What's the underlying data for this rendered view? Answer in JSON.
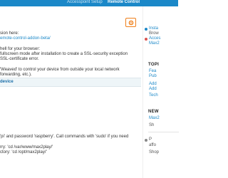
{
  "nav": {
    "tabs": [
      {
        "label": "Accesspoint Setup"
      },
      {
        "label": "Remote Control"
      }
    ]
  },
  "main": {
    "lines": [
      "sion here:",
      "emote-control-addon-beta/",
      "hell for your browser:",
      "fullscreen mode after installation to create a SSL-security exception",
      "SSL-certificate error.",
      "'Weaved' to control your device from outside your local network",
      "forwarding, etc.).",
      "'pi' and password 'raspberry'. Call commands with 'sudo' if you need",
      "rry: 'cd /var/www/max2play/'",
      "ctory: 'cd /opt/max2play/'"
    ],
    "panel_title": "device",
    "settings_icon": "gear-icon"
  },
  "sidebar": {
    "items_top": [
      {
        "label": "Insta",
        "style": "link",
        "icon": "info-dot"
      },
      {
        "label": "Brow",
        "style": "muted"
      },
      {
        "label": "Acces",
        "style": "link",
        "icon": "info-dot"
      },
      {
        "label": "Max2",
        "style": "muted"
      }
    ],
    "topics_heading": "TOPI",
    "topics": [
      {
        "label": "Fea"
      },
      {
        "label": "Pub"
      },
      {
        "label": "Add"
      },
      {
        "label": "Add"
      },
      {
        "label": "Tech"
      }
    ],
    "news_heading": "NEW",
    "news": [
      {
        "label": "Max2"
      },
      {
        "label": "Sh"
      }
    ],
    "footer": [
      {
        "label": "P",
        "icon": "paypal-icon"
      },
      {
        "label": "affo"
      },
      {
        "label": "Shop"
      }
    ],
    "accent_colors": {
      "nav": "#1b88c8",
      "button": "#ef7f1a",
      "info": "#1b88c8",
      "warn": "#d9534f"
    }
  }
}
